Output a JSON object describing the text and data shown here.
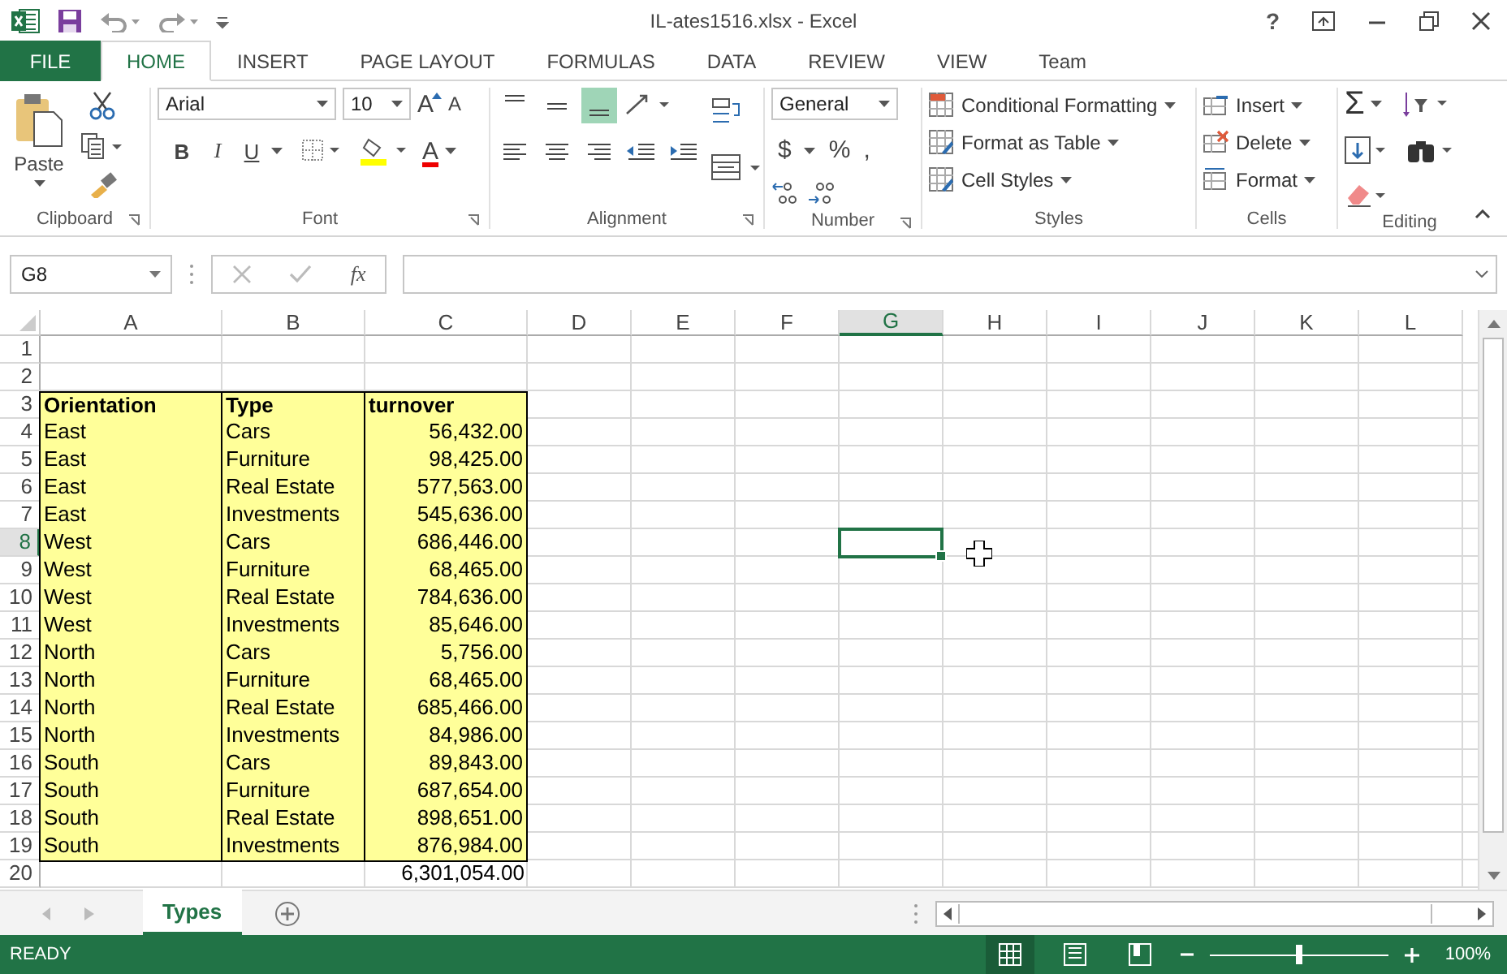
{
  "window": {
    "title": "IL-ates1516.xlsx - Excel",
    "help": "?"
  },
  "tabs": [
    {
      "label": "FILE",
      "kind": "file",
      "selected": false
    },
    {
      "label": "HOME",
      "kind": "tab",
      "selected": true
    },
    {
      "label": "INSERT",
      "kind": "tab",
      "selected": false
    },
    {
      "label": "PAGE LAYOUT",
      "kind": "tab",
      "selected": false
    },
    {
      "label": "FORMULAS",
      "kind": "tab",
      "selected": false
    },
    {
      "label": "DATA",
      "kind": "tab",
      "selected": false
    },
    {
      "label": "REVIEW",
      "kind": "tab",
      "selected": false
    },
    {
      "label": "VIEW",
      "kind": "tab",
      "selected": false
    },
    {
      "label": "Team",
      "kind": "tab",
      "selected": false
    }
  ],
  "ribbon": {
    "clipboard": {
      "label": "Clipboard",
      "paste": "Paste"
    },
    "font": {
      "label": "Font",
      "name": "Arial",
      "size": "10",
      "grow": "A",
      "shrink": "A",
      "styles": [
        "B",
        "I",
        "U"
      ],
      "color_letter": "A"
    },
    "alignment": {
      "label": "Alignment",
      "vertical": [
        {
          "selected": false
        },
        {
          "selected": false
        },
        {
          "selected": true
        }
      ]
    },
    "number": {
      "label": "Number",
      "format": "General",
      "symbols": [
        "$",
        "%",
        ","
      ]
    },
    "styles": {
      "label": "Styles",
      "items": [
        "Conditional Formatting",
        "Format as Table",
        "Cell Styles"
      ]
    },
    "cells": {
      "label": "Cells",
      "items": [
        "Insert",
        "Delete",
        "Format"
      ]
    },
    "editing": {
      "label": "Editing",
      "sum": "Σ"
    }
  },
  "formula_bar": {
    "name_box": "G8",
    "function_label": "fx"
  },
  "sheet": {
    "columns": [
      {
        "letter": "A",
        "selected": false
      },
      {
        "letter": "B",
        "selected": false
      },
      {
        "letter": "C",
        "selected": false
      },
      {
        "letter": "D",
        "selected": false
      },
      {
        "letter": "E",
        "selected": false
      },
      {
        "letter": "F",
        "selected": false
      },
      {
        "letter": "G",
        "selected": true
      },
      {
        "letter": "H",
        "selected": false
      },
      {
        "letter": "I",
        "selected": false
      },
      {
        "letter": "J",
        "selected": false
      },
      {
        "letter": "K",
        "selected": false
      },
      {
        "letter": "L",
        "selected": false
      }
    ],
    "rows": [
      {
        "number": "1",
        "selected": false
      },
      {
        "number": "2",
        "selected": false
      },
      {
        "number": "3",
        "kind": "header",
        "selected": false,
        "cells": [
          "Orientation",
          "Type",
          "turnover"
        ]
      },
      {
        "number": "4",
        "kind": "data",
        "selected": false,
        "cells": [
          "East",
          "Cars",
          "56,432.00"
        ]
      },
      {
        "number": "5",
        "kind": "data",
        "selected": false,
        "cells": [
          "East",
          "Furniture",
          "98,425.00"
        ]
      },
      {
        "number": "6",
        "kind": "data",
        "selected": false,
        "cells": [
          "East",
          "Real Estate",
          "577,563.00"
        ]
      },
      {
        "number": "7",
        "kind": "data",
        "selected": false,
        "cells": [
          "East",
          "Investments",
          "545,636.00"
        ]
      },
      {
        "number": "8",
        "kind": "data",
        "selected": true,
        "cells": [
          "West",
          "Cars",
          "686,446.00"
        ]
      },
      {
        "number": "9",
        "kind": "data",
        "selected": false,
        "cells": [
          "West",
          "Furniture",
          "68,465.00"
        ]
      },
      {
        "number": "10",
        "kind": "data",
        "selected": false,
        "cells": [
          "West",
          "Real Estate",
          "784,636.00"
        ]
      },
      {
        "number": "11",
        "kind": "data",
        "selected": false,
        "cells": [
          "West",
          "Investments",
          "85,646.00"
        ]
      },
      {
        "number": "12",
        "kind": "data",
        "selected": false,
        "cells": [
          "North",
          "Cars",
          "5,756.00"
        ]
      },
      {
        "number": "13",
        "kind": "data",
        "selected": false,
        "cells": [
          "North",
          "Furniture",
          "68,465.00"
        ]
      },
      {
        "number": "14",
        "kind": "data",
        "selected": false,
        "cells": [
          "North",
          "Real Estate",
          "685,466.00"
        ]
      },
      {
        "number": "15",
        "kind": "data",
        "selected": false,
        "cells": [
          "North",
          "Investments",
          "84,986.00"
        ]
      },
      {
        "number": "16",
        "kind": "data",
        "selected": false,
        "cells": [
          "South",
          "Cars",
          "89,843.00"
        ]
      },
      {
        "number": "17",
        "kind": "data",
        "selected": false,
        "cells": [
          "South",
          "Furniture",
          "687,654.00"
        ]
      },
      {
        "number": "18",
        "kind": "data",
        "selected": false,
        "cells": [
          "South",
          "Real Estate",
          "898,651.00"
        ]
      },
      {
        "number": "19",
        "kind": "data",
        "selected": false,
        "cells": [
          "South",
          "Investments",
          "876,984.00"
        ]
      },
      {
        "number": "20",
        "kind": "total",
        "selected": false,
        "cells": [
          "6,301,054.00"
        ]
      }
    ]
  },
  "sheet_tabs": [
    {
      "label": "Types",
      "selected": true
    }
  ],
  "status_bar": {
    "status": "READY",
    "zoom": "100%",
    "zoom_slider": {
      "level": 0.5
    },
    "views": [
      {
        "selected": true
      },
      {
        "selected": false
      },
      {
        "selected": false
      }
    ]
  }
}
